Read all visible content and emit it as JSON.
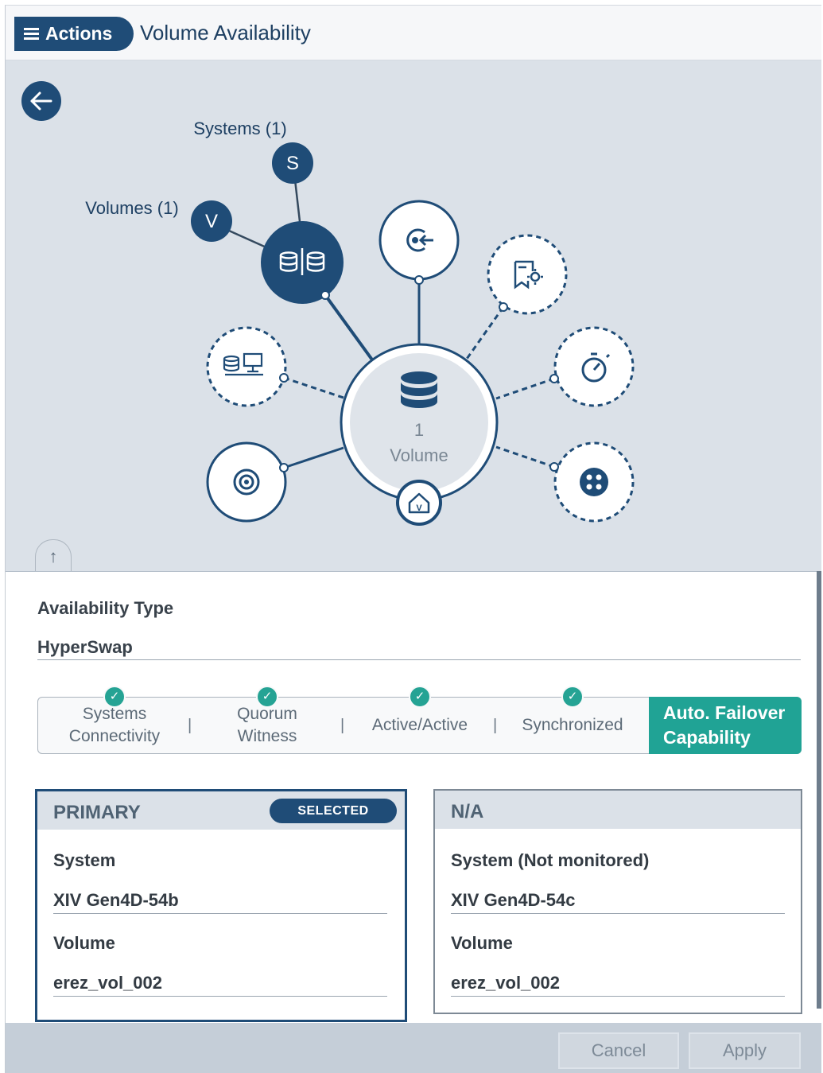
{
  "header": {
    "actions_label": "Actions",
    "title": "Volume Availability"
  },
  "topology": {
    "systems_label": "Systems (1)",
    "systems_letter": "S",
    "volumes_label": "Volumes (1)",
    "volumes_letter": "V",
    "center_count": "1",
    "center_label": "Volume",
    "home_letter": "V"
  },
  "details": {
    "availability_type_label": "Availability Type",
    "availability_type_value": "HyperSwap",
    "steps": [
      {
        "line1": "Systems",
        "line2": "Connectivity",
        "status": "check"
      },
      {
        "line1": "Quorum",
        "line2": "Witness",
        "status": "check"
      },
      {
        "line1": "Active/Active",
        "status": "check"
      },
      {
        "line1": "Synchronized",
        "status": "check"
      },
      {
        "line1": "Auto. Failover",
        "line2": "Capability",
        "status": "active"
      }
    ],
    "separator": "|",
    "primary": {
      "title": "PRIMARY",
      "badge": "SELECTED",
      "system_label": "System",
      "system_value": "XIV Gen4D-54b",
      "volume_label": "Volume",
      "volume_value": "erez_vol_002"
    },
    "secondary": {
      "title": "N/A",
      "system_label": "System (Not monitored)",
      "system_value": "XIV Gen4D-54c",
      "volume_label": "Volume",
      "volume_value": "erez_vol_002"
    }
  },
  "footer": {
    "cancel_label": "Cancel",
    "apply_label": "Apply"
  },
  "colors": {
    "brand_navy": "#1f4c77",
    "accent_teal": "#20a395",
    "panel_bg": "#dbe1e8"
  }
}
